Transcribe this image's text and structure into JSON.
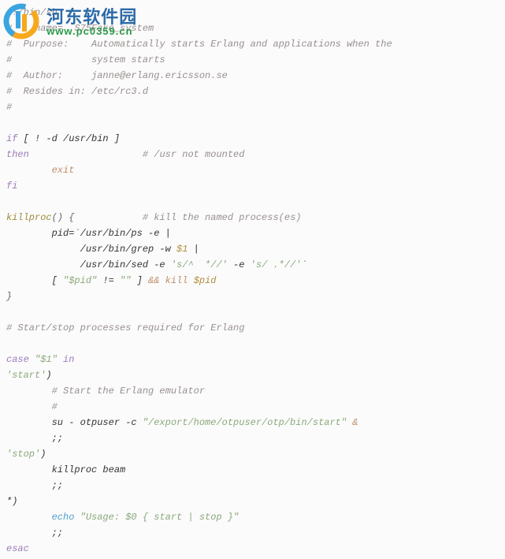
{
  "watermark": {
    "title": "河东软件园",
    "url": "www.pc0359.cn"
  },
  "code": {
    "l1_shebang": "#!/bin/sh",
    "l2_c1": "#",
    "l2_name": "    name=  S75Fake_system",
    "l3_c1": "#  Purpose:    Automatically starts Erlang and applications when the",
    "l4_c1": "#              system starts",
    "l5_c1": "#  Author:     janne@erlang.ericsson.se",
    "l6_c1": "#  Resides in: /etc/rc3.d",
    "l7_c1": "#",
    "l_if": "if",
    "l_if_cond": " [ ! -d /usr/bin ]",
    "l_then": "then",
    "l_then_cmt": "                    # /usr not mounted",
    "l_exit": "        exit",
    "l_fi": "fi",
    "l_kill_fn": "killproc",
    "l_kill_paren": "() {",
    "l_kill_cmt": "            # kill the named process(es)",
    "l_pid_assign": "        pid=",
    "l_pid_tick": "`",
    "l_pid_cmd": "/usr/bin/ps -e |",
    "l_grep": "             /usr/bin/grep -w ",
    "l_grep_arg": "$1",
    "l_grep_pipe": " |",
    "l_sed": "             /usr/bin/sed -e ",
    "l_sed_s1": "'s/^  *//'",
    "l_sed_mid": " -e ",
    "l_sed_s2": "'s/ .*//'",
    "l_sed_end": "`",
    "l_test_open": "        [ ",
    "l_test_pid": "\"$pid\"",
    "l_test_ne": " != ",
    "l_test_empty": "\"\"",
    "l_test_close": " ] ",
    "l_test_and": "&&",
    "l_test_kill": " kill ",
    "l_test_kill_arg": "$pid",
    "l_brace_close": "}",
    "l_startstop_cmt": "# Start/stop processes required for Erlang",
    "l_case": "case",
    "l_case_arg": " \"$1\" ",
    "l_case_in": "in",
    "l_start_lbl": "'start'",
    "l_start_paren": ")",
    "l_start_cmt1": "        # Start the Erlang emulator",
    "l_start_cmt2": "        #",
    "l_su": "        su - otpuser -c ",
    "l_su_str": "\"/export/home/otpuser/otp/bin/start\"",
    "l_su_amp": " &",
    "l_dsemi1": "        ;;",
    "l_stop_lbl": "'stop'",
    "l_stop_paren": ")",
    "l_killbeam": "        killproc beam",
    "l_dsemi2": "        ;;",
    "l_star": "*)",
    "l_echo": "        echo ",
    "l_echo_str": "\"Usage: $0 { start | stop }\"",
    "l_dsemi3": "        ;;",
    "l_esac": "esac"
  }
}
